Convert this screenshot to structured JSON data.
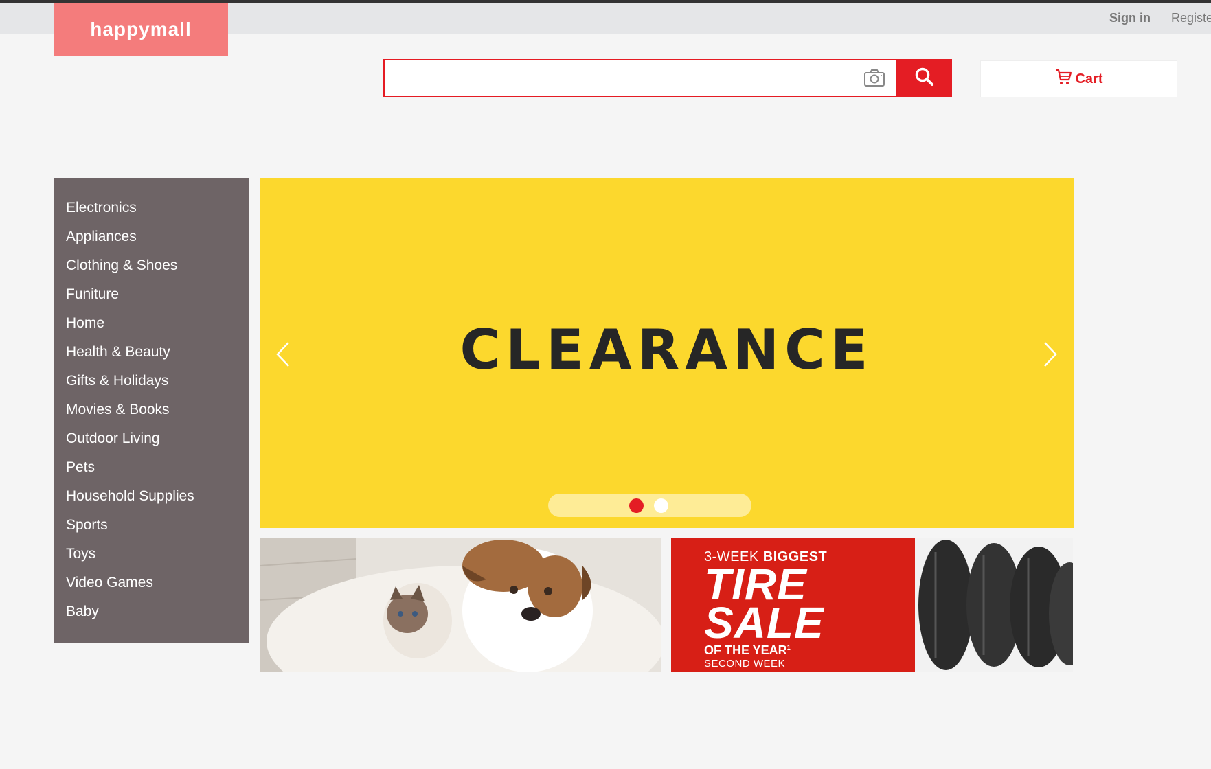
{
  "header": {
    "logo_text": "happymall",
    "sign_in_label": "Sign in",
    "register_label": "Register",
    "search": {
      "value": "",
      "placeholder": ""
    },
    "cart_label": "Cart"
  },
  "colors": {
    "brand_red": "#e41d24",
    "logo_pink": "#f47c7c",
    "sidebar_bg": "#6e6466",
    "banner_yellow": "#fcd82d"
  },
  "sidebar": {
    "items": [
      {
        "label": "Electronics"
      },
      {
        "label": "Appliances"
      },
      {
        "label": "Clothing & Shoes"
      },
      {
        "label": "Funiture"
      },
      {
        "label": "Home"
      },
      {
        "label": "Health & Beauty"
      },
      {
        "label": "Gifts & Holidays"
      },
      {
        "label": "Movies & Books"
      },
      {
        "label": "Outdoor Living"
      },
      {
        "label": "Pets"
      },
      {
        "label": "Household Supplies"
      },
      {
        "label": "Sports"
      },
      {
        "label": "Toys"
      },
      {
        "label": "Video Games"
      },
      {
        "label": "Baby"
      }
    ]
  },
  "carousel": {
    "slide_text": "CLEARANCE",
    "total_slides": 2,
    "active_slide": 1
  },
  "promos": {
    "tire": {
      "line1_normal": "3-WEEK",
      "line1_bold": "BIGGEST",
      "line2": "TIRE",
      "line3": "SALE",
      "line4": "OF THE YEAR",
      "line4_sup": "1",
      "line5": "SECOND WEEK"
    }
  },
  "icons": {
    "camera": "camera-icon",
    "search": "search-icon",
    "cart": "cart-icon",
    "prev": "chevron-left-icon",
    "next": "chevron-right-icon"
  }
}
